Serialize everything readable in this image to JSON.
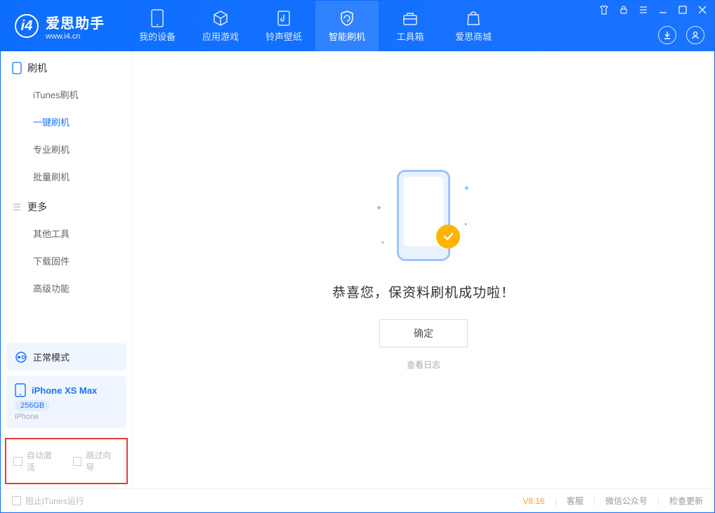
{
  "app": {
    "title": "爱思助手",
    "subtitle": "www.i4.cn"
  },
  "nav": {
    "tabs": [
      {
        "label": "我的设备"
      },
      {
        "label": "应用游戏"
      },
      {
        "label": "铃声壁纸"
      },
      {
        "label": "智能刷机"
      },
      {
        "label": "工具箱"
      },
      {
        "label": "爱思商城"
      }
    ]
  },
  "sidebar": {
    "section1": {
      "title": "刷机",
      "items": [
        "iTunes刷机",
        "一键刷机",
        "专业刷机",
        "批量刷机"
      ],
      "active_index": 1
    },
    "section2": {
      "title": "更多",
      "items": [
        "其他工具",
        "下载固件",
        "高级功能"
      ]
    },
    "mode_card": {
      "label": "正常模式"
    },
    "device_card": {
      "name": "iPhone XS Max",
      "capacity": "256GB",
      "type": "iPhone"
    },
    "opts": {
      "auto_activate": "自动激活",
      "skip_guide": "跳过向导"
    }
  },
  "main": {
    "success_text": "恭喜您，保资料刷机成功啦！",
    "ok_button": "确定",
    "view_log": "查看日志"
  },
  "statusbar": {
    "block_itunes": "阻止iTunes运行",
    "version": "V8.16",
    "links": [
      "客服",
      "微信公众号",
      "检查更新"
    ]
  },
  "colors": {
    "accent": "#1a73ff",
    "highlight_border": "#e23b3b",
    "badge": "#ffb400"
  }
}
